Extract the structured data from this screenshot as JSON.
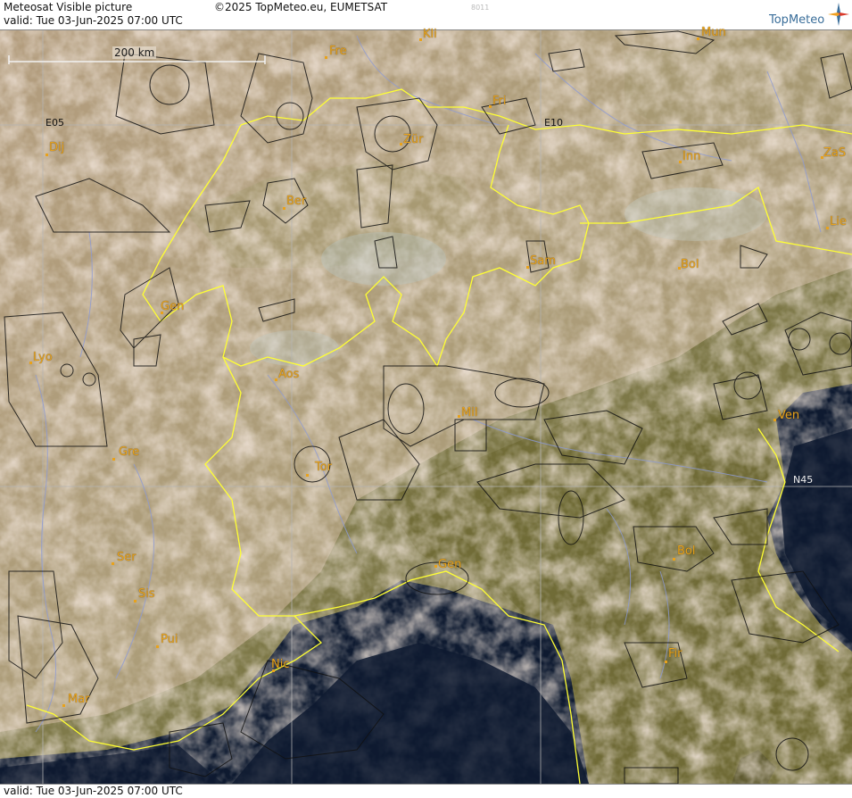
{
  "header": {
    "title": "Meteosat Visible picture",
    "valid": "valid:  Tue  03-Jun-2025  07:00 UTC",
    "copyright": "©2025 TopMeteo.eu, EUMETSAT",
    "code": "8011",
    "logo_text": "TopMeteo"
  },
  "footer": {
    "valid": "valid:  Tue  03-Jun-2025  07:00 UTC"
  },
  "scale": {
    "label": "200 km"
  },
  "grid_labels": {
    "e05": "E05",
    "e10": "E10",
    "n45": "N45"
  },
  "cities": {
    "fre": "Fre",
    "kli": "Kli",
    "mun": "Mun",
    "dij": "Dij",
    "zur": "Zür",
    "fri": "Fri",
    "inn": "Inn",
    "zas": "ZaS",
    "ber": "Ber",
    "lie": "Lie",
    "sam": "Sam",
    "bol_n": "Bol",
    "gen_ch": "Gen",
    "lyo": "Lyo",
    "aos": "Aos",
    "mil": "Mil",
    "ven": "Ven",
    "gre": "Gre",
    "tor": "Tor",
    "ser": "Ser",
    "bol_s": "Bol",
    "gen_it": "Gen",
    "sis": "Sis",
    "pui": "Pui",
    "fir": "Fir",
    "nic": "Nic",
    "mar": "Mar"
  },
  "colors": {
    "land": "#9a8a5e",
    "cloud": "#d9bfa8",
    "sea": "#0e1a30",
    "border": "#ffff33",
    "city": "#e8a21c",
    "river": "#8c9ad6",
    "airspace": "#111111",
    "grid": "#b4b4b4"
  }
}
